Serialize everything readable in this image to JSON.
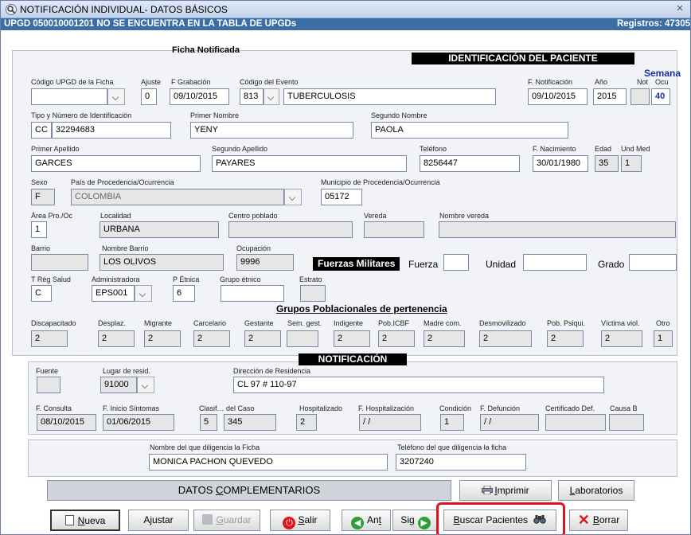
{
  "window": {
    "title": "NOTIFICACIÓN INDIVIDUAL- DATOS BÁSICOS",
    "close_label": "✕",
    "warning": "UPGD 050010001201 NO SE ENCUENTRA EN LA TABLA DE UPGDs",
    "records": "Registros: 47305"
  },
  "sections": {
    "ficha_notificada": "Ficha Notificada",
    "identificacion": "IDENTIFICACIÓN DEL PACIENTE",
    "grupos": "Grupos Poblacionales de pertenencia",
    "notificacion": "NOTIFICACIÓN",
    "fuerzas": "Fuerzas Militares"
  },
  "labels": {
    "codigo_upgd": "Código UPGD de la Ficha",
    "ajuste": "Ajuste",
    "f_grabacion": "F Grabación",
    "codigo_evento": "Código del Evento",
    "f_notificacion": "F. Notificación",
    "anio": "Año",
    "semana": "Semana",
    "not": "Not",
    "ocu": "Ocu",
    "tipo_numero_id": "Tipo y Número de Identificación",
    "primer_nombre": "Primer Nombre",
    "segundo_nombre": "Segundo Nombre",
    "primer_apellido": "Primer Apellido",
    "segundo_apellido": "Segundo Apellido",
    "telefono": "Teléfono",
    "f_nacimiento": "F. Nacimiento",
    "edad": "Edad",
    "und_med": "Und Med",
    "sexo": "Sexo",
    "pais": "País de Procedencia/Ocurrencia",
    "municipio": "Municipio de Procedencia/Ocurrencia",
    "area": "Área Pro./Oc",
    "localidad": "Localidad",
    "centro_poblado": "Centro poblado",
    "vereda": "Vereda",
    "nombre_vereda": "Nombre vereda",
    "barrio": "Barrio",
    "nombre_barrio": "Nombre Barrio",
    "ocupacion": "Ocupación",
    "fuerza": "Fuerza",
    "unidad": "Unidad",
    "grado": "Grado",
    "t_reg_salud": "T Rég Salud",
    "administradora": "Administradora",
    "p_etnica": "P Étnica",
    "grupo_etnico": "Grupo étnico",
    "estrato": "Estrato",
    "fuente": "Fuente",
    "lugar_resid": "Lugar de resid.",
    "direccion": "Dirección de Residencia",
    "f_consulta": "F. Consulta",
    "f_inicio_sintomas": "F. Inicio Síntomas",
    "clasif_caso": "Clasif… del Caso",
    "hospitalizado": "Hospitalizado",
    "f_hospitalizacion": "F. Hospitalización",
    "condicion": "Condición",
    "f_defuncion": "F. Defunción",
    "certificado_def": "Certificado Def.",
    "causa_b": "Causa B",
    "nombre_diligencia": "Nombre del que diligencia la Ficha",
    "telefono_diligencia": "Teléfono del que diligencia la ficha"
  },
  "values": {
    "codigo_upgd": "",
    "ajuste": "0",
    "f_grabacion": "09/10/2015",
    "codigo_evento": "813",
    "evento_nombre": "TUBERCULOSIS",
    "f_notificacion": "09/10/2015",
    "anio": "2015",
    "semana_not": "",
    "semana_ocu": "40",
    "tipo_id": "CC",
    "numero_id": "32294683",
    "primer_nombre": "YENY",
    "segundo_nombre": "PAOLA",
    "primer_apellido": "GARCES",
    "segundo_apellido": "PAYARES",
    "telefono": "8256447",
    "f_nacimiento": "30/01/1980",
    "edad": "35",
    "und_med": "1",
    "sexo": "F",
    "pais": "COLOMBIA",
    "municipio": "05172",
    "area": "1",
    "localidad": "URBANA",
    "centro_poblado": "",
    "vereda": "",
    "nombre_vereda": "",
    "barrio": "",
    "nombre_barrio": "LOS OLIVOS",
    "ocupacion": "9996",
    "fuerza": "",
    "unidad": "",
    "grado": "",
    "t_reg_salud": "C",
    "administradora": "EPS001",
    "p_etnica": "6",
    "grupo_etnico": "",
    "estrato": "",
    "fuente": "",
    "lugar_resid": "91000",
    "direccion": "CL 97 # 110-97",
    "f_consulta": "08/10/2015",
    "f_inicio_sintomas": "01/06/2015",
    "clasif_a": "5",
    "clasif_b": "345",
    "hospitalizado": "2",
    "f_hospitalizacion": "/ /",
    "condicion": "1",
    "f_defuncion": "/ /",
    "certificado_def": "",
    "causa_b": "",
    "nombre_diligencia": "MONICA PACHON QUEVEDO",
    "telefono_diligencia": "3207240"
  },
  "grupos": [
    {
      "label": "Discapacitado",
      "value": "2"
    },
    {
      "label": "Desplaz.",
      "value": "2"
    },
    {
      "label": "Migrante",
      "value": "2"
    },
    {
      "label": "Carcelario",
      "value": "2"
    },
    {
      "label": "Gestante",
      "value": "2"
    },
    {
      "label": "Sem. gest.",
      "value": ""
    },
    {
      "label": "Indigente",
      "value": "2"
    },
    {
      "label": "Pob.ICBF",
      "value": "2"
    },
    {
      "label": "Madre com.",
      "value": "2"
    },
    {
      "label": "Desmovilizado",
      "value": "2"
    },
    {
      "label": "Pob. Psiqui.",
      "value": "2"
    },
    {
      "label": "Víctima viol.",
      "value": "2"
    },
    {
      "label": "Otro",
      "value": "1"
    }
  ],
  "buttons": {
    "datos_complementarios_pre": "DATOS ",
    "datos_complementarios_key": "C",
    "datos_complementarios_post": "OMPLEMENTARIOS",
    "imprimir_key": "I",
    "imprimir_post": "mprimir",
    "laboratorios_key": "L",
    "laboratorios_post": "aboratorios",
    "nueva_key": "N",
    "nueva_post": "ueva",
    "ajustar_pre": "A",
    "ajustar_key": "j",
    "ajustar_post": "ustar",
    "guardar_key": "G",
    "guardar_post": "uardar",
    "salir_key": "S",
    "salir_post": "alir",
    "ant_pre": "An",
    "ant_key": "t",
    "sig_pre": "Si",
    "sig_key": "g",
    "buscar_key": "B",
    "buscar_post": "uscar Pacientes",
    "borrar_key": "B",
    "borrar_post": "orrar"
  },
  "colors": {
    "highlight": "#e0141e",
    "title_blue": "#1d2f9c",
    "warning_bar": "#3b6ea5"
  }
}
